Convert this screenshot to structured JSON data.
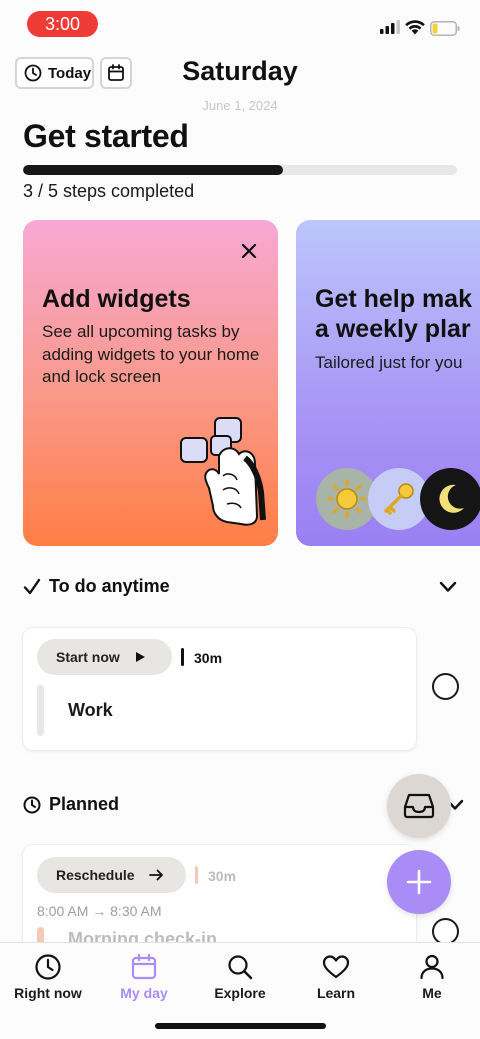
{
  "status_bar": {
    "time": "3:00"
  },
  "header": {
    "today_label": "Today",
    "title": "Saturday",
    "date": "June 1, 2024"
  },
  "get_started": {
    "title": "Get started",
    "progress_fraction": 0.6,
    "progress_text": "3 / 5 steps completed"
  },
  "cards": [
    {
      "title": "Add widgets",
      "description": "See all upcoming tasks by adding widgets to your home and lock screen"
    },
    {
      "title_line1": "Get help mak",
      "title_line2": "a weekly plar",
      "description": "Tailored just for you"
    }
  ],
  "todo_anytime": {
    "section_title": "To do anytime",
    "task": {
      "action_label": "Start now",
      "duration": "30m",
      "name": "Work"
    }
  },
  "planned": {
    "section_title": "Planned",
    "task": {
      "action_label": "Reschedule",
      "duration": "30m",
      "time_range": "8:00 AM → 8:30 AM",
      "name": "Morning check-in"
    }
  },
  "tabs": [
    {
      "label": "Right now",
      "icon": "clock-icon"
    },
    {
      "label": "My day",
      "icon": "calendar-icon",
      "active": true
    },
    {
      "label": "Explore",
      "icon": "search-icon"
    },
    {
      "label": "Learn",
      "icon": "heart-icon"
    },
    {
      "label": "Me",
      "icon": "person-icon"
    }
  ],
  "colors": {
    "accent": "#a98cf5",
    "record_pill": "#ee3b35",
    "planned_accent": "#f7c8b8"
  }
}
